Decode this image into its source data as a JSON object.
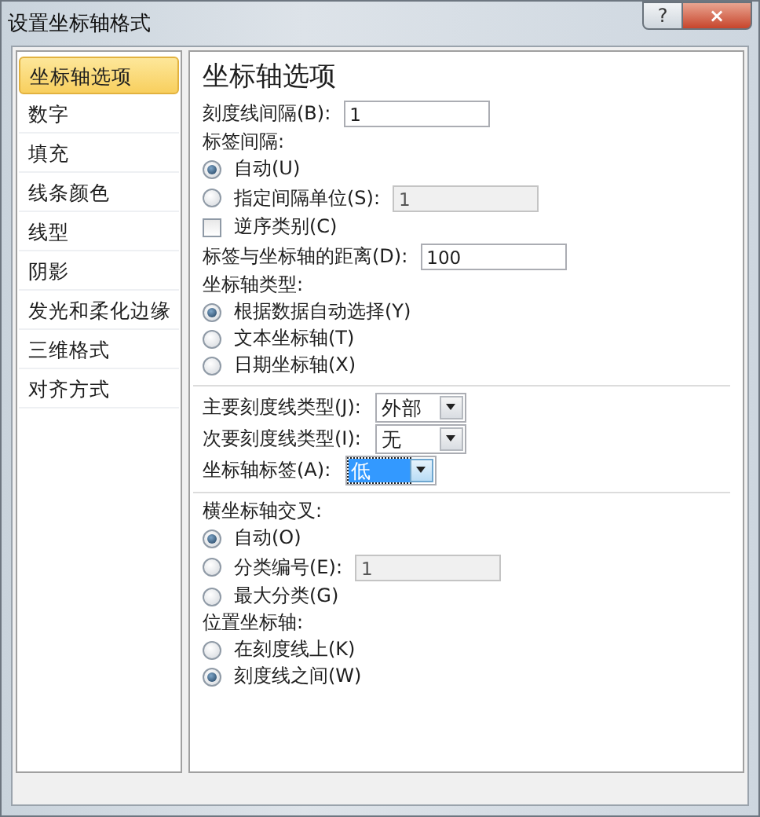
{
  "window": {
    "title": "设置坐标轴格式",
    "help_button": "?",
    "close_button": "×"
  },
  "sidebar": {
    "items": [
      {
        "label": "坐标轴选项",
        "selected": true
      },
      {
        "label": "数字",
        "selected": false
      },
      {
        "label": "填充",
        "selected": false
      },
      {
        "label": "线条颜色",
        "selected": false
      },
      {
        "label": "线型",
        "selected": false
      },
      {
        "label": "阴影",
        "selected": false
      },
      {
        "label": "发光和柔化边缘",
        "selected": false
      },
      {
        "label": "三维格式",
        "selected": false
      },
      {
        "label": "对齐方式",
        "selected": false
      }
    ]
  },
  "panel": {
    "heading": "坐标轴选项",
    "rows": [
      {
        "kind": "field",
        "label": "刻度线间隔(B):",
        "value": "1",
        "disabled": false
      },
      {
        "kind": "caption",
        "label": "标签间隔:"
      },
      {
        "kind": "radio",
        "label": "自动(U)",
        "selected": true
      },
      {
        "kind": "radio",
        "label": "指定间隔单位(S):",
        "selected": false,
        "value": "1",
        "disabled": true
      },
      {
        "kind": "checkbox",
        "label": "逆序类别(C)",
        "checked": false
      },
      {
        "kind": "field",
        "label": "标签与坐标轴的距离(D):",
        "value": "100",
        "disabled": false
      },
      {
        "kind": "caption",
        "label": "坐标轴类型:"
      },
      {
        "kind": "radio",
        "label": "根据数据自动选择(Y)",
        "selected": true
      },
      {
        "kind": "radio",
        "label": "文本坐标轴(T)",
        "selected": false
      },
      {
        "kind": "radio",
        "label": "日期坐标轴(X)",
        "selected": false
      },
      {
        "kind": "divider"
      },
      {
        "kind": "select",
        "label": "主要刻度线类型(J):",
        "value": "外部",
        "focused": false
      },
      {
        "kind": "select",
        "label": "次要刻度线类型(I):",
        "value": "无",
        "focused": false
      },
      {
        "kind": "select",
        "label": "坐标轴标签(A):",
        "value": "低",
        "focused": true
      },
      {
        "kind": "divider"
      },
      {
        "kind": "caption",
        "label": "横坐标轴交叉:"
      },
      {
        "kind": "radio",
        "label": "自动(O)",
        "selected": true
      },
      {
        "kind": "radio",
        "label": "分类编号(E):",
        "selected": false,
        "value": "1",
        "disabled": true
      },
      {
        "kind": "radio",
        "label": "最大分类(G)",
        "selected": false
      },
      {
        "kind": "caption",
        "label": "位置坐标轴:"
      },
      {
        "kind": "radio",
        "label": "在刻度线上(K)",
        "selected": false
      },
      {
        "kind": "radio",
        "label": "刻度线之间(W)",
        "selected": true
      }
    ]
  }
}
